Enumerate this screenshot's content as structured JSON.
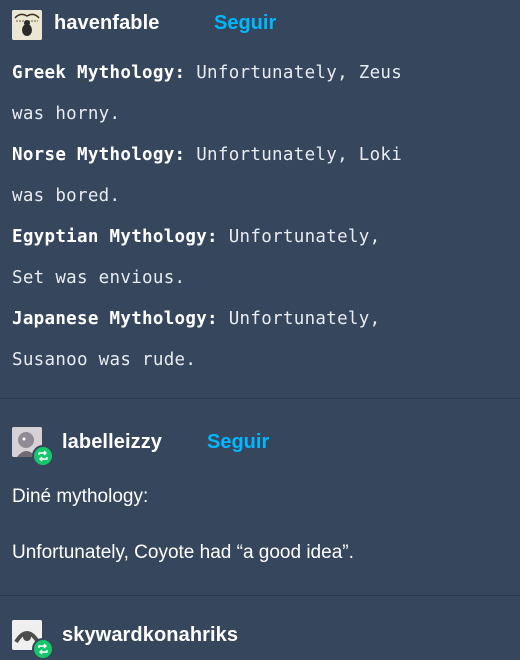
{
  "posts": [
    {
      "username": "havenfable",
      "follow_label": "Seguir",
      "lines": [
        {
          "bold": "Greek Mythology:",
          "text": " Unfortunately, Zeus"
        },
        {
          "bold": "",
          "text": "was horny."
        },
        {
          "bold": "Norse Mythology:",
          "text": " Unfortunately, Loki"
        },
        {
          "bold": "",
          "text": "was bored."
        },
        {
          "bold": "Egyptian Mythology:",
          "text": " Unfortunately,"
        },
        {
          "bold": "",
          "text": "Set was envious."
        },
        {
          "bold": "Japanese Mythology:",
          "text": " Unfortunately,"
        },
        {
          "bold": "",
          "text": "Susanoo was rude."
        }
      ]
    },
    {
      "username": "labelleizzy",
      "follow_label": "Seguir",
      "paragraph_1": "Diné mythology:",
      "paragraph_2": "Unfortunately, Coyote had “a good idea”."
    },
    {
      "username": "skywardkonahriks"
    }
  ],
  "colors": {
    "background": "#36465d",
    "follow_link": "#00b8ff",
    "reblog_badge": "#16c66a"
  }
}
